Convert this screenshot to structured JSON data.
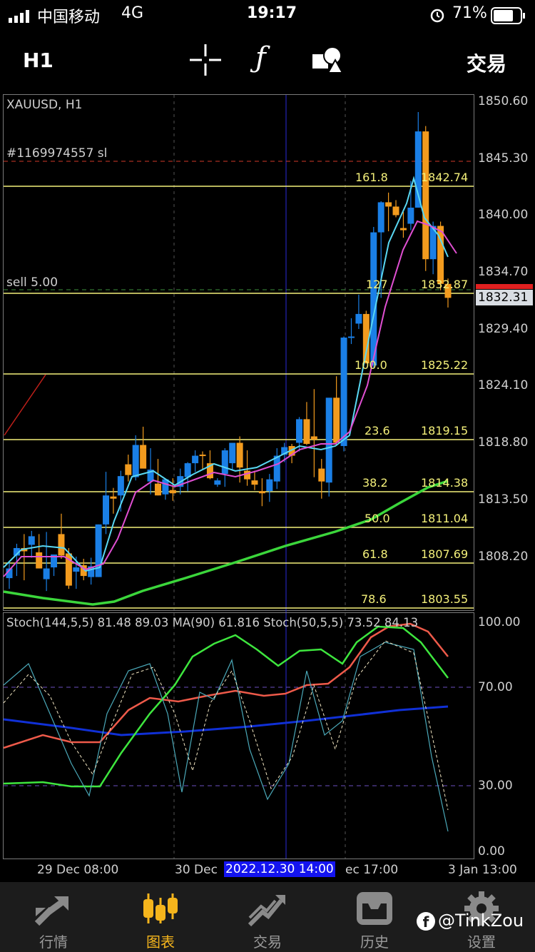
{
  "status_bar": {
    "carrier": "中国移动",
    "network": "4G",
    "time": "19:17",
    "battery": "71%"
  },
  "toolbar": {
    "timeframe": "H1",
    "trade_label": "交易",
    "icons": [
      "crosshair-icon",
      "function-icon",
      "objects-icon"
    ]
  },
  "chart": {
    "symbol_label": "XAUUSD, H1",
    "sl_label": "#1169974557 sl",
    "order_label": "sell 5.00",
    "current_price": "1832.31",
    "price_ticks": [
      "1850.60",
      "1845.30",
      "1840.00",
      "1834.70",
      "1829.40",
      "1824.10",
      "1818.80",
      "1813.50",
      "1808.20"
    ],
    "time_ticks": [
      "29 Dec 08:00",
      "30 Dec",
      "2022.12.30 14:00",
      "ec 17:00",
      "3 Jan 13:00"
    ],
    "fib_levels": [
      {
        "ratio": "161.8",
        "price": "1842.74"
      },
      {
        "ratio": "127",
        "price": "1832.87"
      },
      {
        "ratio": "100.0",
        "price": "1825.22"
      },
      {
        "ratio": "23.6",
        "price": "1819.15"
      },
      {
        "ratio": "38.2",
        "price": "1814.38"
      },
      {
        "ratio": "50.0",
        "price": "1811.04"
      },
      {
        "ratio": "61.8",
        "price": "1807.69"
      },
      {
        "ratio": "78.6",
        "price": "1803.55"
      }
    ],
    "colors": {
      "bull": "#1a7fe6",
      "bear": "#f29b1e",
      "fib": "#f4f07a",
      "ma_green": "#3bd63b",
      "ma_cyan": "#59d7f2",
      "ma_magenta": "#e04fd2",
      "sl_line": "#ff3b30"
    }
  },
  "stoch": {
    "label": "Stoch(144,5,5) 81.48 89.03 MA(90) 61.816 Stoch(50,5,5) 73.52 84.13",
    "ticks": [
      "100.00",
      "70.00",
      "30.00",
      "0.00"
    ]
  },
  "nav": {
    "items": [
      {
        "label": "行情",
        "icon": "quotes-icon"
      },
      {
        "label": "图表",
        "icon": "chart-icon"
      },
      {
        "label": "交易",
        "icon": "trade-icon"
      },
      {
        "label": "历史",
        "icon": "history-icon"
      },
      {
        "label": "设置",
        "icon": "settings-icon"
      }
    ],
    "watermark": "@TinkZou"
  }
}
